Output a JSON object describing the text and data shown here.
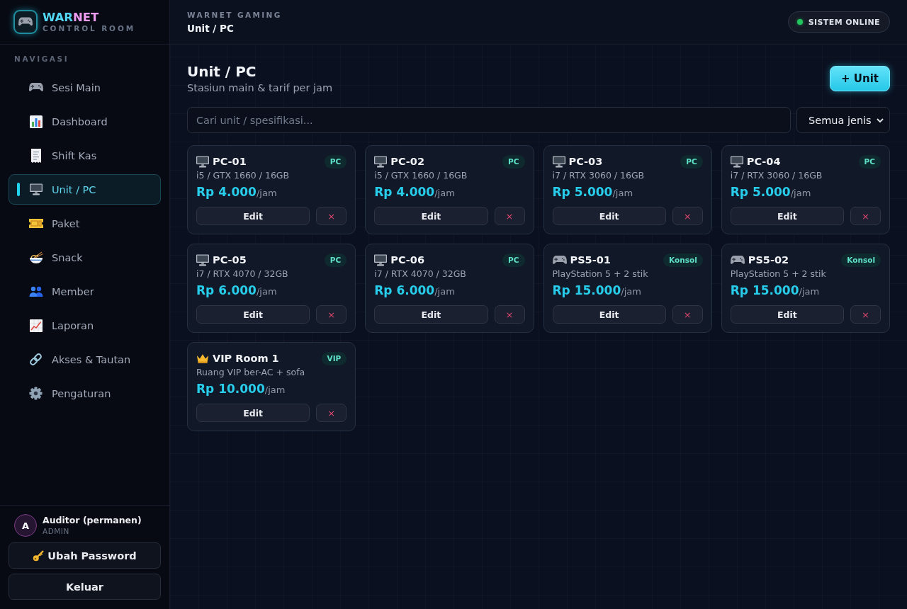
{
  "sidebar": {
    "brand": {
      "name_start": "WAR",
      "name_end": "NET",
      "subtitle": "CONTROL ROOM"
    },
    "nav_heading": "NAVIGASI",
    "nav_items": [
      {
        "label": "Sesi Main",
        "selected": false
      },
      {
        "label": "Dashboard",
        "selected": false
      },
      {
        "label": "Shift Kas",
        "selected": false
      },
      {
        "label": "Unit / PC",
        "selected": true
      },
      {
        "label": "Paket",
        "selected": false
      },
      {
        "label": "Snack",
        "selected": false
      },
      {
        "label": "Member",
        "selected": false
      },
      {
        "label": "Laporan",
        "selected": false
      },
      {
        "label": "Akses & Tautan",
        "selected": false
      },
      {
        "label": "Pengaturan",
        "selected": false
      }
    ],
    "user": {
      "initial": "A",
      "name": "Auditor (permanen)",
      "role": "ADMIN"
    },
    "buttons": [
      {
        "kind": "password",
        "label": "Ubah Password"
      },
      {
        "kind": "logout",
        "label": "Keluar"
      }
    ]
  },
  "header": {
    "overline": "WARNET GAMING",
    "title": "Unit / PC",
    "status": "SISTEM ONLINE"
  },
  "page": {
    "title": "Unit / PC",
    "subtitle": "Stasiun main & tarif per jam",
    "add_button": "+ Unit",
    "search": {
      "placeholder": "Cari unit / spesifikasi..."
    },
    "filter": {
      "value": "Semua jenis"
    }
  },
  "units": [
    {
      "kind": "pc",
      "name": "PC-01",
      "badge": "PC",
      "spec": "i5 / GTX 1660 / 16GB",
      "price": "Rp 4.000",
      "per": "/jam",
      "edit": "Edit",
      "delete": "×"
    },
    {
      "kind": "pc",
      "name": "PC-02",
      "badge": "PC",
      "spec": "i5 / GTX 1660 / 16GB",
      "price": "Rp 4.000",
      "per": "/jam",
      "edit": "Edit",
      "delete": "×"
    },
    {
      "kind": "pc",
      "name": "PC-03",
      "badge": "PC",
      "spec": "i7 / RTX 3060 / 16GB",
      "price": "Rp 5.000",
      "per": "/jam",
      "edit": "Edit",
      "delete": "×"
    },
    {
      "kind": "pc",
      "name": "PC-04",
      "badge": "PC",
      "spec": "i7 / RTX 3060 / 16GB",
      "price": "Rp 5.000",
      "per": "/jam",
      "edit": "Edit",
      "delete": "×"
    },
    {
      "kind": "pc",
      "name": "PC-05",
      "badge": "PC",
      "spec": "i7 / RTX 4070 / 32GB",
      "price": "Rp 6.000",
      "per": "/jam",
      "edit": "Edit",
      "delete": "×"
    },
    {
      "kind": "pc",
      "name": "PC-06",
      "badge": "PC",
      "spec": "i7 / RTX 4070 / 32GB",
      "price": "Rp 6.000",
      "per": "/jam",
      "edit": "Edit",
      "delete": "×"
    },
    {
      "kind": "console",
      "name": "PS5-01",
      "badge": "Konsol",
      "spec": "PlayStation 5 + 2 stik",
      "price": "Rp 15.000",
      "per": "/jam",
      "edit": "Edit",
      "delete": "×"
    },
    {
      "kind": "console",
      "name": "PS5-02",
      "badge": "Konsol",
      "spec": "PlayStation 5 + 2 stik",
      "price": "Rp 15.000",
      "per": "/jam",
      "edit": "Edit",
      "delete": "×"
    },
    {
      "kind": "vip",
      "name": "VIP Room 1",
      "badge": "VIP",
      "spec": "Ruang VIP ber-AC + sofa",
      "price": "Rp 10.000",
      "per": "/jam",
      "edit": "Edit",
      "delete": "×"
    }
  ]
}
